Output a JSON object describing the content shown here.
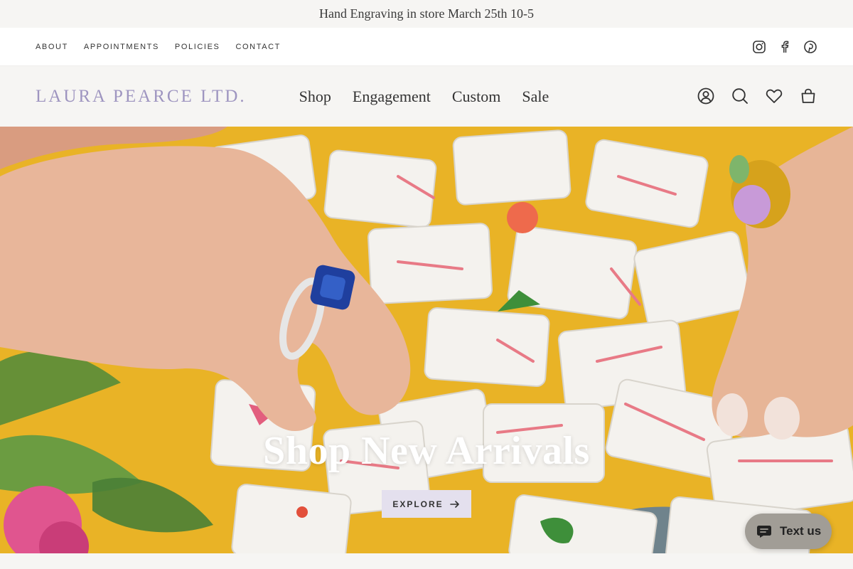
{
  "announcement": {
    "text": "Hand Engraving in store March 25th 10-5"
  },
  "utility_nav": {
    "links": [
      "ABOUT",
      "APPOINTMENTS",
      "POLICIES",
      "CONTACT"
    ],
    "social_icons": [
      "instagram-icon",
      "facebook-icon",
      "pinterest-icon"
    ]
  },
  "header": {
    "logo": "LAURA PEARCE LTD.",
    "nav": [
      "Shop",
      "Engagement",
      "Custom",
      "Sale"
    ],
    "icons": [
      "account-icon",
      "search-icon",
      "wishlist-icon",
      "cart-icon"
    ]
  },
  "hero": {
    "title": "Shop New Arrivals",
    "button_label": "EXPLORE",
    "button_icon": "arrow-right-icon"
  },
  "chat_widget": {
    "label": "Text us",
    "icon": "chat-bubble-icon"
  },
  "colors": {
    "logo": "#9e95c0",
    "button_bg": "#e4e0ee",
    "hero_table": "#e9b326",
    "chat_widget": "#a19d96"
  }
}
